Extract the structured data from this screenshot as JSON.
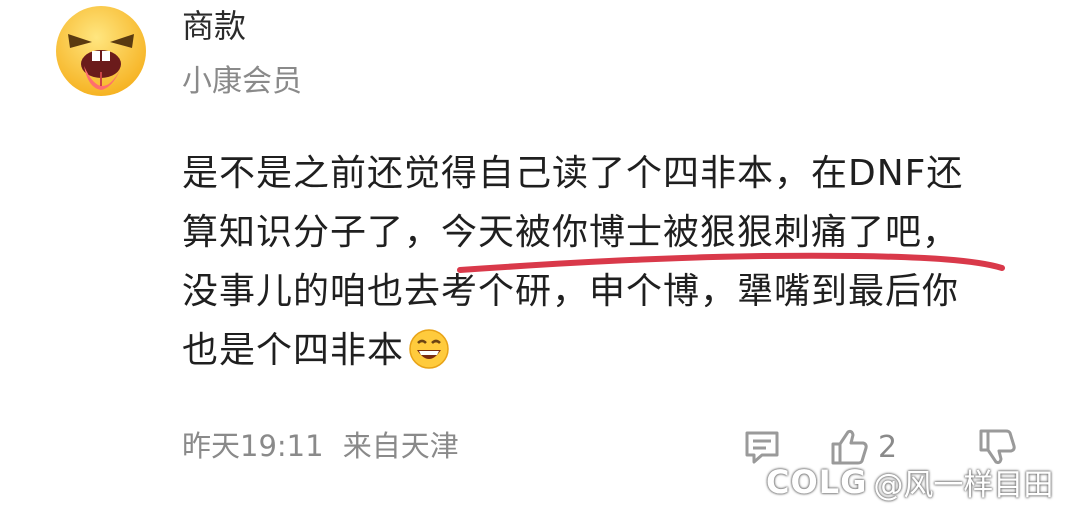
{
  "comment": {
    "author": "商款",
    "badge": "小康会员",
    "lines": [
      "是不是之前还觉得自己读了个四非本，在DNF还",
      "算知识分子了，",
      "今天被你博士被狠狠刺痛了吧，",
      "没事儿的咱也去考个研，申个博，犟嘴到最后你",
      "也是个四非本"
    ],
    "emoji": "grinning-face",
    "highlight_color": "#d9394a",
    "timestamp": "昨天19:11",
    "location": "来自天津",
    "like_count": "2"
  },
  "watermark": {
    "logo": "COLG",
    "handle": "@风一样目田"
  }
}
